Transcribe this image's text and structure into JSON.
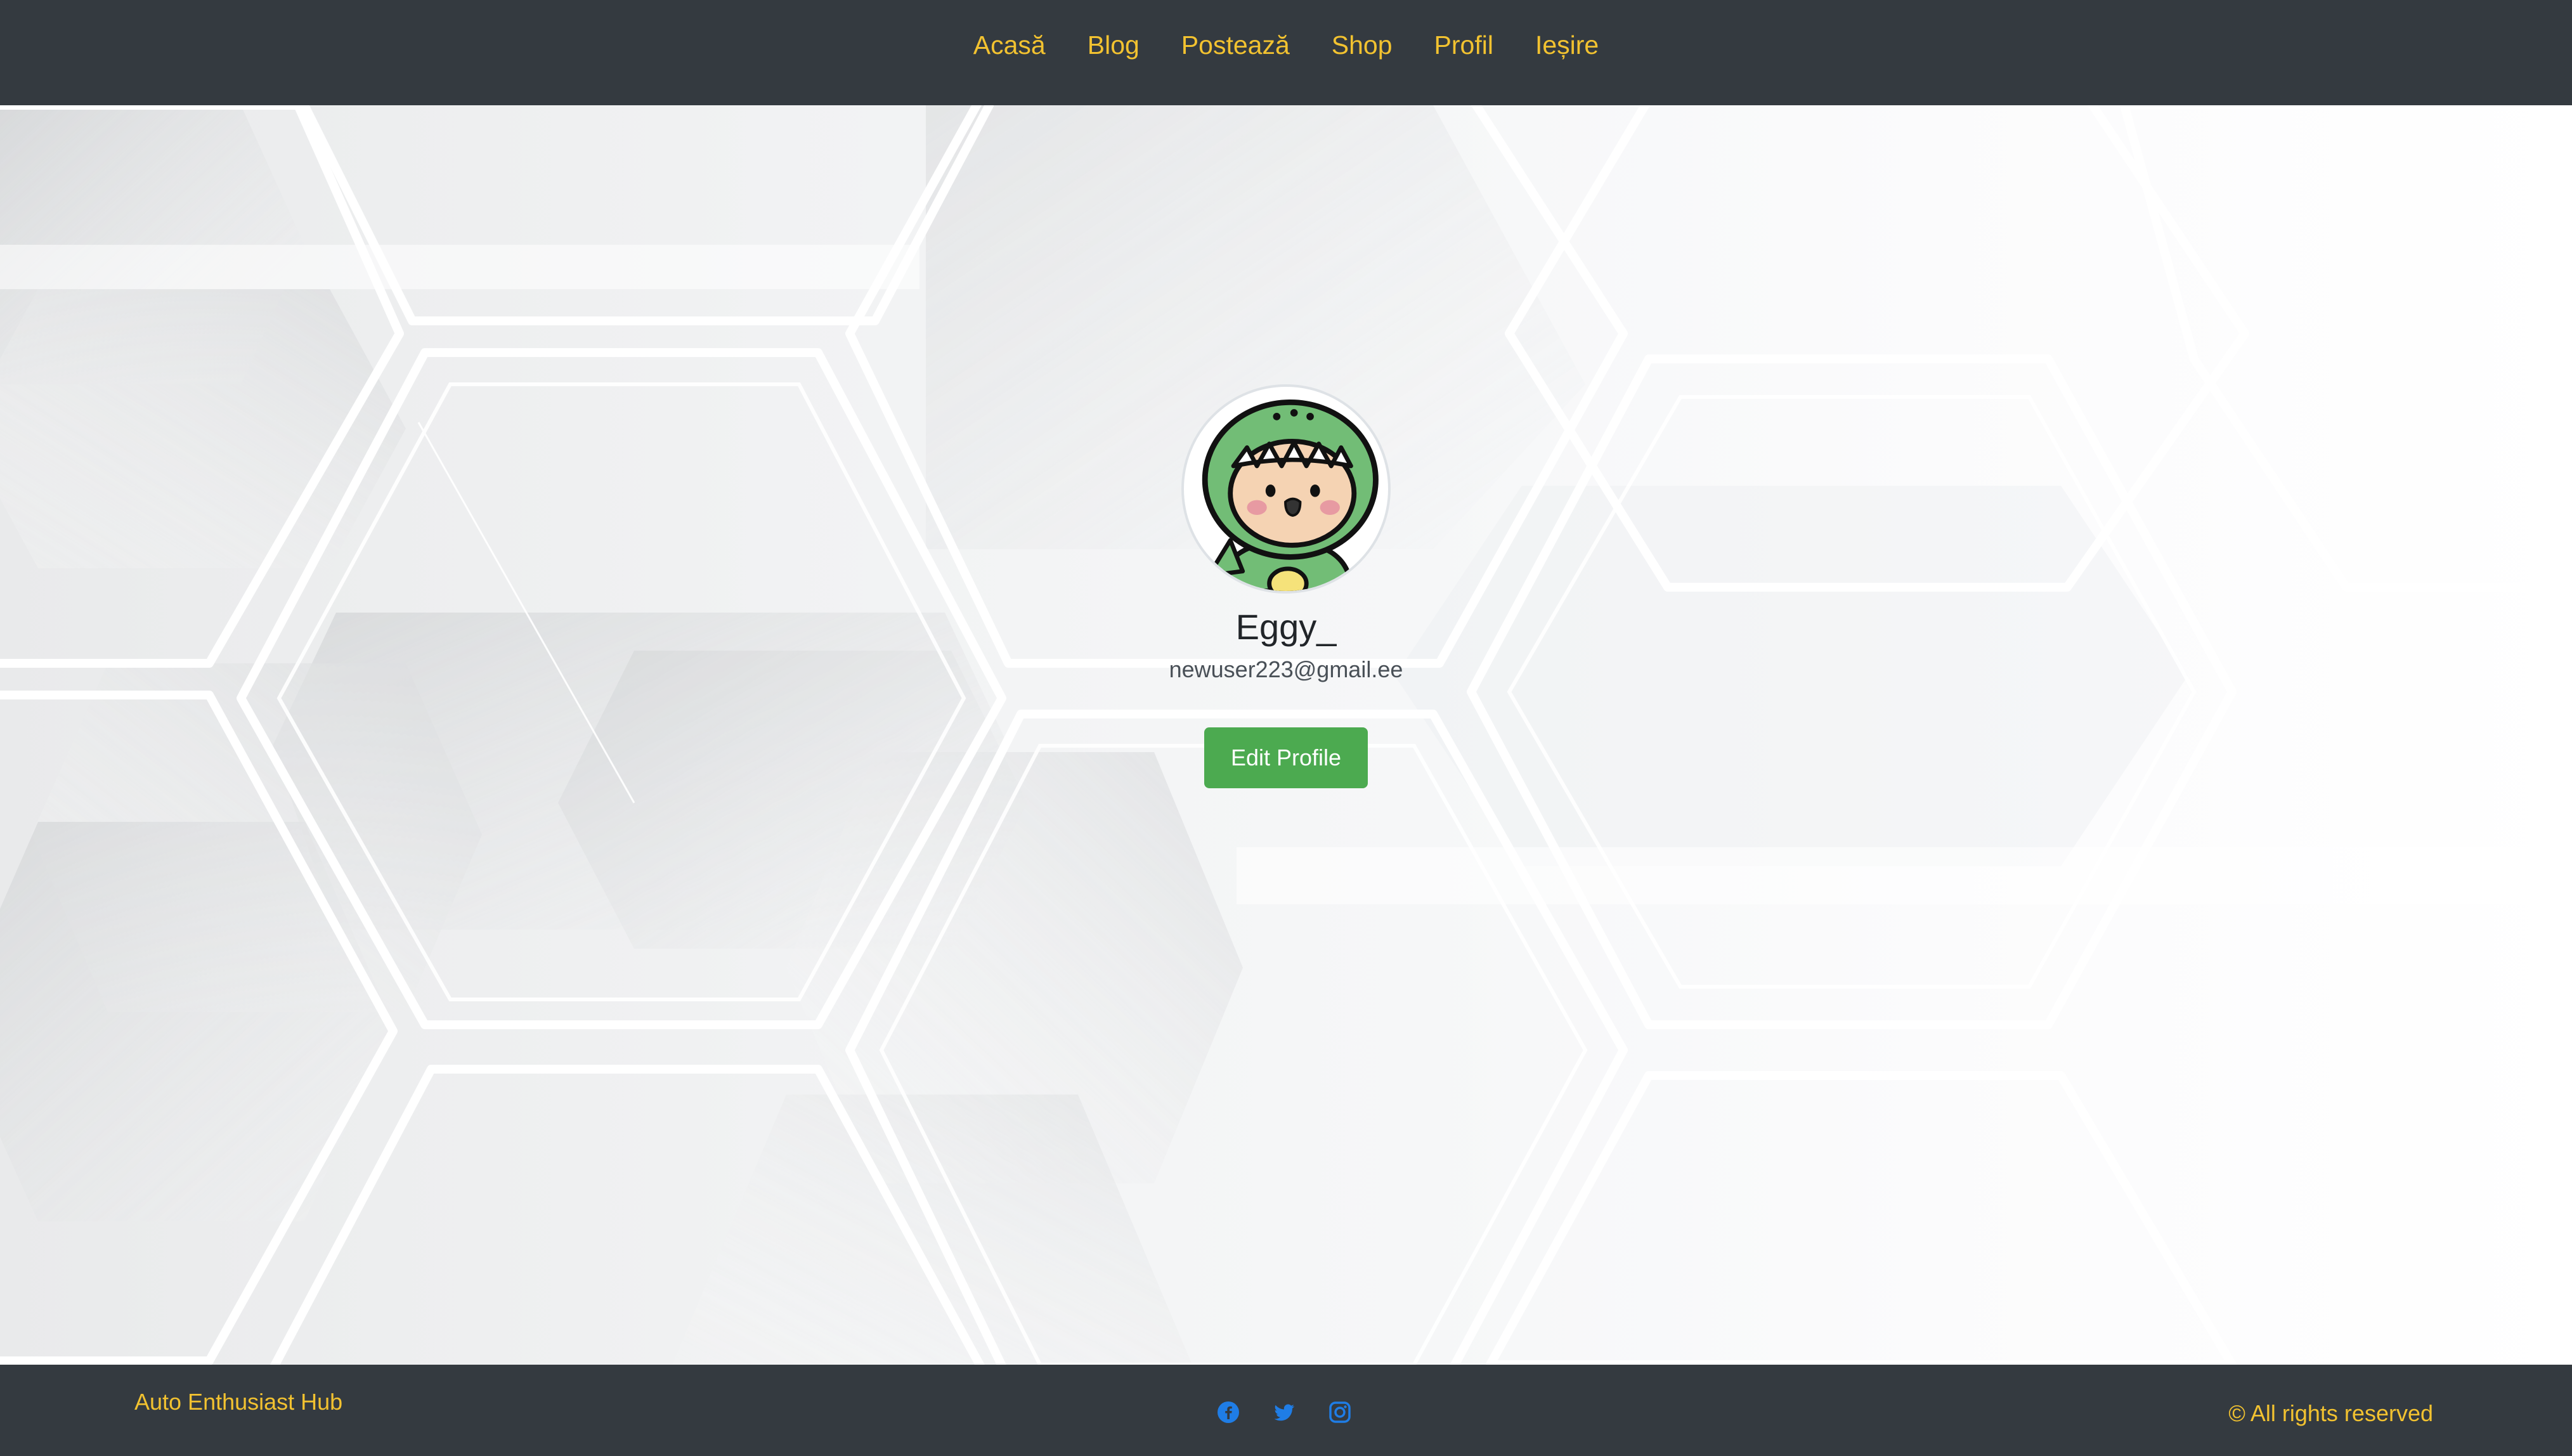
{
  "nav": {
    "items": [
      {
        "label": "Acasă"
      },
      {
        "label": "Blog"
      },
      {
        "label": "Postează"
      },
      {
        "label": "Shop"
      },
      {
        "label": "Profil"
      },
      {
        "label": "Ieșire"
      }
    ]
  },
  "profile": {
    "avatar_icon": "dinosaur-costume-avatar",
    "username": "Eggy_",
    "email": "newuser223@gmail.ee",
    "edit_label": "Edit Profile"
  },
  "footer": {
    "brand": "Auto Enthusiast Hub",
    "social": [
      {
        "icon": "facebook-icon"
      },
      {
        "icon": "twitter-icon"
      },
      {
        "icon": "instagram-icon"
      }
    ],
    "copyright": "© All rights reserved"
  },
  "colors": {
    "navbar_bg": "#343a40",
    "nav_link": "#f2c230",
    "button_bg": "#4caa50",
    "social_icon": "#1f7de6"
  }
}
